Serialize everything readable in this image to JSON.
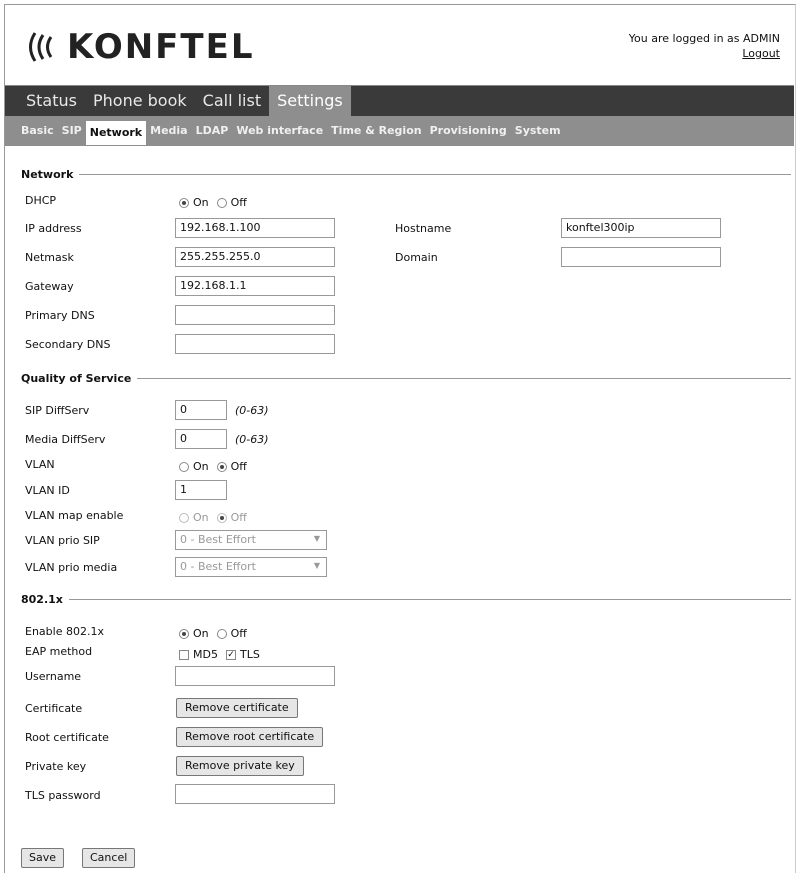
{
  "header": {
    "logo_text": "KONFTEL",
    "login_text": "You are logged in as ADMIN",
    "logout_label": "Logout"
  },
  "main_tabs": [
    {
      "label": "Status"
    },
    {
      "label": "Phone book"
    },
    {
      "label": "Call list"
    },
    {
      "label": "Settings",
      "active": true
    }
  ],
  "sub_tabs": [
    {
      "label": "Basic"
    },
    {
      "label": "SIP"
    },
    {
      "label": "Network",
      "active": true
    },
    {
      "label": "Media"
    },
    {
      "label": "LDAP"
    },
    {
      "label": "Web interface"
    },
    {
      "label": "Time & Region"
    },
    {
      "label": "Provisioning"
    },
    {
      "label": "System"
    }
  ],
  "network": {
    "legend": "Network",
    "dhcp_label": "DHCP",
    "dhcp_on": "On",
    "dhcp_off": "Off",
    "ip_label": "IP address",
    "ip_value": "192.168.1.100",
    "netmask_label": "Netmask",
    "netmask_value": "255.255.255.0",
    "gateway_label": "Gateway",
    "gateway_value": "192.168.1.1",
    "primary_dns_label": "Primary DNS",
    "primary_dns_value": "",
    "secondary_dns_label": "Secondary DNS",
    "secondary_dns_value": "",
    "hostname_label": "Hostname",
    "hostname_value": "konftel300ip",
    "domain_label": "Domain",
    "domain_value": ""
  },
  "qos": {
    "legend": "Quality of Service",
    "sip_diffserv_label": "SIP DiffServ",
    "sip_diffserv_value": "0",
    "range_hint": "(0-63)",
    "media_diffserv_label": "Media DiffServ",
    "media_diffserv_value": "0",
    "vlan_label": "VLAN",
    "on": "On",
    "off": "Off",
    "vlan_id_label": "VLAN ID",
    "vlan_id_value": "1",
    "vlan_map_label": "VLAN map enable",
    "vlan_prio_sip_label": "VLAN prio SIP",
    "vlan_prio_sip_value": "0 - Best Effort",
    "vlan_prio_media_label": "VLAN prio media",
    "vlan_prio_media_value": "0 - Best Effort"
  },
  "dot1x": {
    "legend": "802.1x",
    "enable_label": "Enable 802.1x",
    "on": "On",
    "off": "Off",
    "eap_label": "EAP method",
    "md5_label": "MD5",
    "tls_label": "TLS",
    "username_label": "Username",
    "username_value": "",
    "certificate_label": "Certificate",
    "remove_certificate": "Remove certificate",
    "root_certificate_label": "Root certificate",
    "remove_root_certificate": "Remove root certificate",
    "private_key_label": "Private key",
    "remove_private_key": "Remove private key",
    "tls_password_label": "TLS password",
    "tls_password_value": ""
  },
  "actions": {
    "save_label": "Save",
    "cancel_label": "Cancel"
  }
}
